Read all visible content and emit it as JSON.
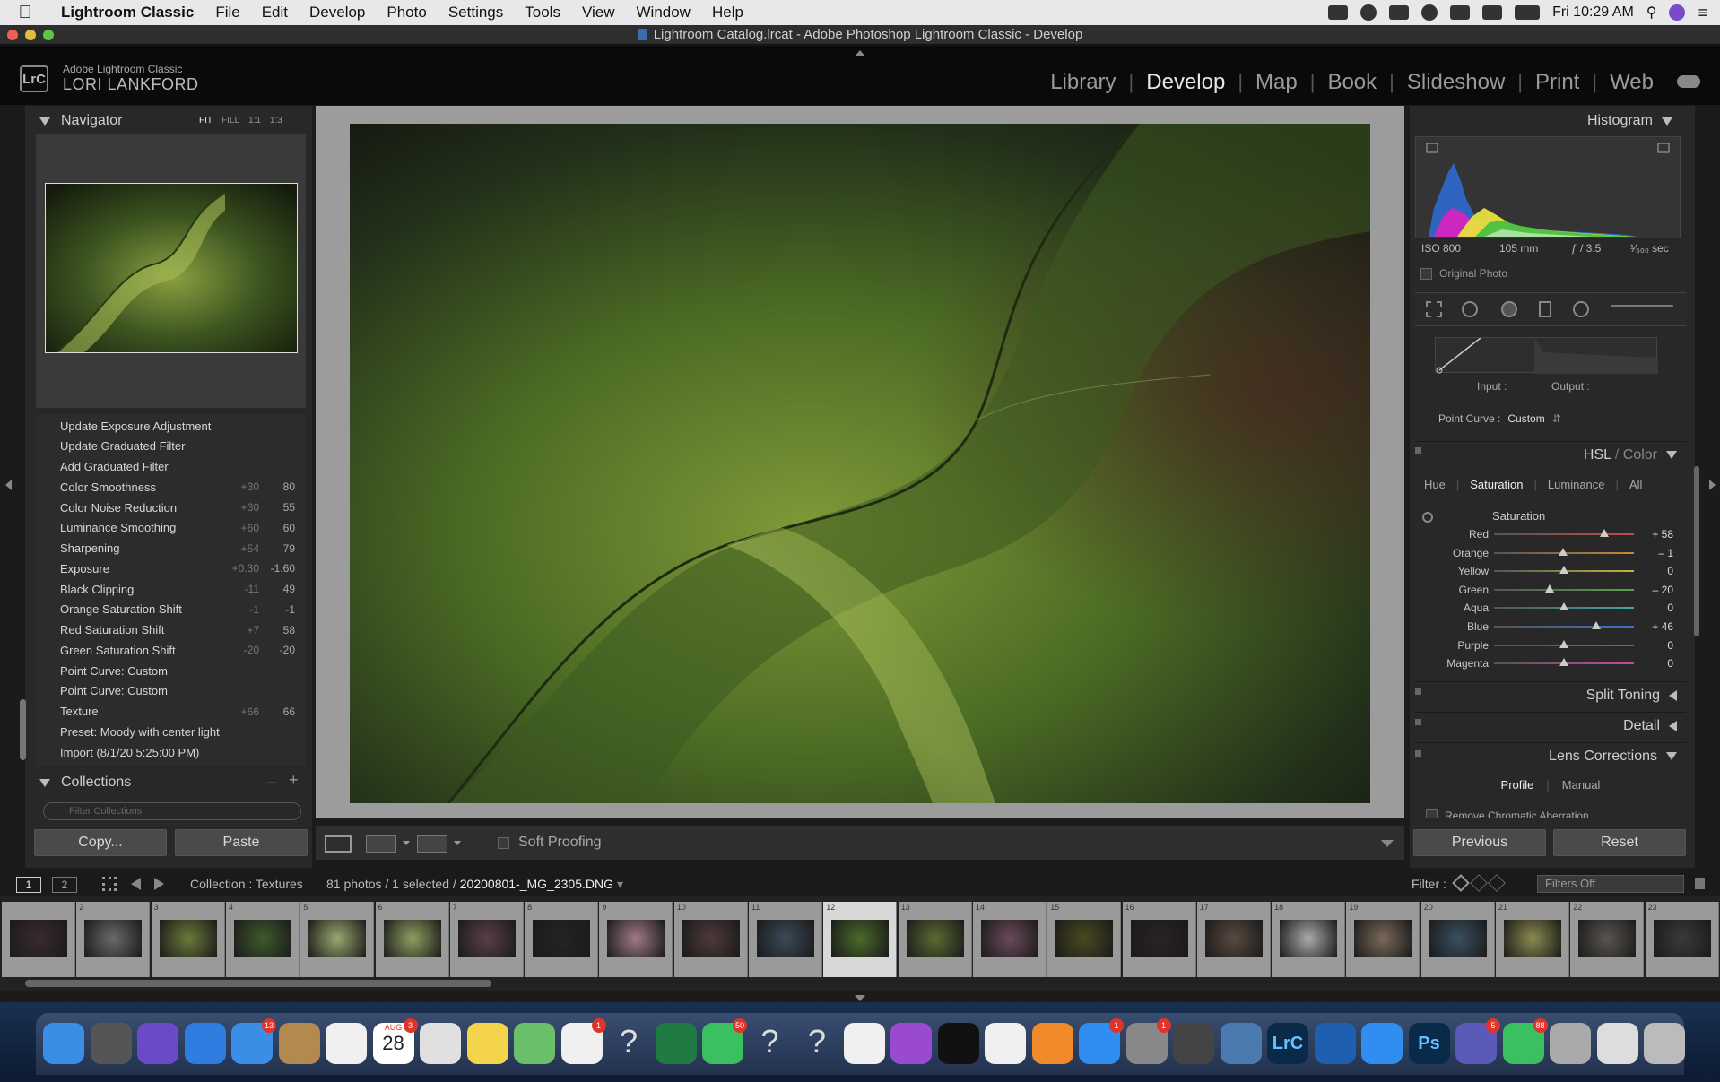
{
  "menubar": {
    "app_name": "Lightroom Classic",
    "items": [
      "File",
      "Edit",
      "Develop",
      "Photo",
      "Settings",
      "Tools",
      "View",
      "Window",
      "Help"
    ],
    "clock": "Fri 10:29 AM"
  },
  "window": {
    "title": "Lightroom Catalog.lrcat - Adobe Photoshop Lightroom Classic - Develop"
  },
  "identity": {
    "badge": "LrC",
    "product": "Adobe Lightroom Classic",
    "user": "LORI LANKFORD"
  },
  "modules": [
    "Library",
    "Develop",
    "Map",
    "Book",
    "Slideshow",
    "Print",
    "Web"
  ],
  "navigator": {
    "title": "Navigator",
    "options": [
      "FIT",
      "FILL",
      "1:1",
      "1:3"
    ]
  },
  "history": [
    {
      "label": "Update Exposure Adjustment",
      "from": "",
      "to": ""
    },
    {
      "label": "Update Graduated Filter",
      "from": "",
      "to": ""
    },
    {
      "label": "Add Graduated Filter",
      "from": "",
      "to": ""
    },
    {
      "label": "Color Smoothness",
      "from": "+30",
      "to": "80"
    },
    {
      "label": "Color Noise Reduction",
      "from": "+30",
      "to": "55"
    },
    {
      "label": "Luminance Smoothing",
      "from": "+60",
      "to": "60"
    },
    {
      "label": "Sharpening",
      "from": "+54",
      "to": "79"
    },
    {
      "label": "Exposure",
      "from": "+0.30",
      "to": "-1.60"
    },
    {
      "label": "Black Clipping",
      "from": "-11",
      "to": "49"
    },
    {
      "label": "Orange Saturation Shift",
      "from": "-1",
      "to": "-1"
    },
    {
      "label": "Red Saturation Shift",
      "from": "+7",
      "to": "58"
    },
    {
      "label": "Green Saturation Shift",
      "from": "-20",
      "to": "-20"
    },
    {
      "label": "Point Curve: Custom",
      "from": "",
      "to": ""
    },
    {
      "label": "Point Curve: Custom",
      "from": "",
      "to": ""
    },
    {
      "label": "Texture",
      "from": "+66",
      "to": "66"
    },
    {
      "label": "Preset: Moody with center light",
      "from": "",
      "to": ""
    },
    {
      "label": "Import (8/1/20 5:25:00 PM)",
      "from": "",
      "to": ""
    }
  ],
  "collections": {
    "title": "Collections",
    "filter_placeholder": "Filter Collections"
  },
  "left_buttons": {
    "copy": "Copy...",
    "paste": "Paste"
  },
  "toolbar": {
    "soft_proofing": "Soft Proofing"
  },
  "histogram": {
    "title": "Histogram",
    "iso": "ISO 800",
    "focal": "105 mm",
    "aperture": "ƒ / 3.5",
    "shutter": "¹⁄₅₀₀ sec",
    "original_photo": "Original Photo"
  },
  "tone_curve": {
    "input": "Input :",
    "output": "Output :",
    "point_curve_label": "Point Curve :",
    "point_curve_value": "Custom"
  },
  "hsl": {
    "title_hsl": "HSL",
    "title_color": "Color",
    "tabs": [
      "Hue",
      "Saturation",
      "Luminance",
      "All"
    ],
    "active_tab": "Saturation",
    "group_label": "Saturation",
    "sliders": [
      {
        "name": "Red",
        "value": "+ 58",
        "num": 58,
        "color": "#c24a4a"
      },
      {
        "name": "Orange",
        "value": "– 1",
        "num": -1,
        "color": "#c8873a"
      },
      {
        "name": "Yellow",
        "value": "0",
        "num": 0,
        "color": "#c4b53c"
      },
      {
        "name": "Green",
        "value": "– 20",
        "num": -20,
        "color": "#57a347"
      },
      {
        "name": "Aqua",
        "value": "0",
        "num": 0,
        "color": "#3fa6a6"
      },
      {
        "name": "Blue",
        "value": "+ 46",
        "num": 46,
        "color": "#3c6fc6"
      },
      {
        "name": "Purple",
        "value": "0",
        "num": 0,
        "color": "#8a4ec2"
      },
      {
        "name": "Magenta",
        "value": "0",
        "num": 0,
        "color": "#c24aa6"
      }
    ]
  },
  "sections": {
    "split_toning": "Split Toning",
    "detail": "Detail",
    "lens_corrections": "Lens Corrections",
    "lens_tabs": [
      "Profile",
      "Manual"
    ],
    "remove_ca": "Remove Chromatic Aberration"
  },
  "right_buttons": {
    "previous": "Previous",
    "reset": "Reset"
  },
  "filmbar": {
    "view1": "1",
    "view2": "2",
    "collection": "Collection : Textures",
    "count": "81 photos / 1 selected /",
    "filename": "20200801-_MG_2305.DNG",
    "filter_label": "Filter :",
    "filter_value": "Filters Off"
  },
  "filmstrip": {
    "numbers": [
      "",
      "2",
      "3",
      "4",
      "5",
      "6",
      "7",
      "8",
      "9",
      "10",
      "11",
      "12",
      "13",
      "14",
      "15",
      "16",
      "17",
      "18",
      "19",
      "20",
      "21",
      "22",
      "23"
    ],
    "colors": [
      "#3a2a30",
      "#6a6a6a",
      "#6b7a3a",
      "#3f5a2c",
      "#9aa870",
      "#8ea060",
      "#5a4048",
      "#222426",
      "#a07a88",
      "#4e3a3a",
      "#3a4a58",
      "#4a6a2a",
      "#5a6a30",
      "#6a4a5a",
      "#4a4a20",
      "#2a2226",
      "#5a4a40",
      "#aaaaaa",
      "#7a6a5a",
      "#3a5060",
      "#8a8a50",
      "#5a5650",
      "#3a3a3a"
    ],
    "selected_index": 11
  },
  "dock": {
    "badges": [
      "13",
      "3",
      "1",
      "1",
      "50",
      "1",
      "1",
      "5",
      "88"
    ],
    "date_month": "AUG",
    "date_day": "28",
    "lrc": "LrC",
    "ps": "Ps"
  }
}
